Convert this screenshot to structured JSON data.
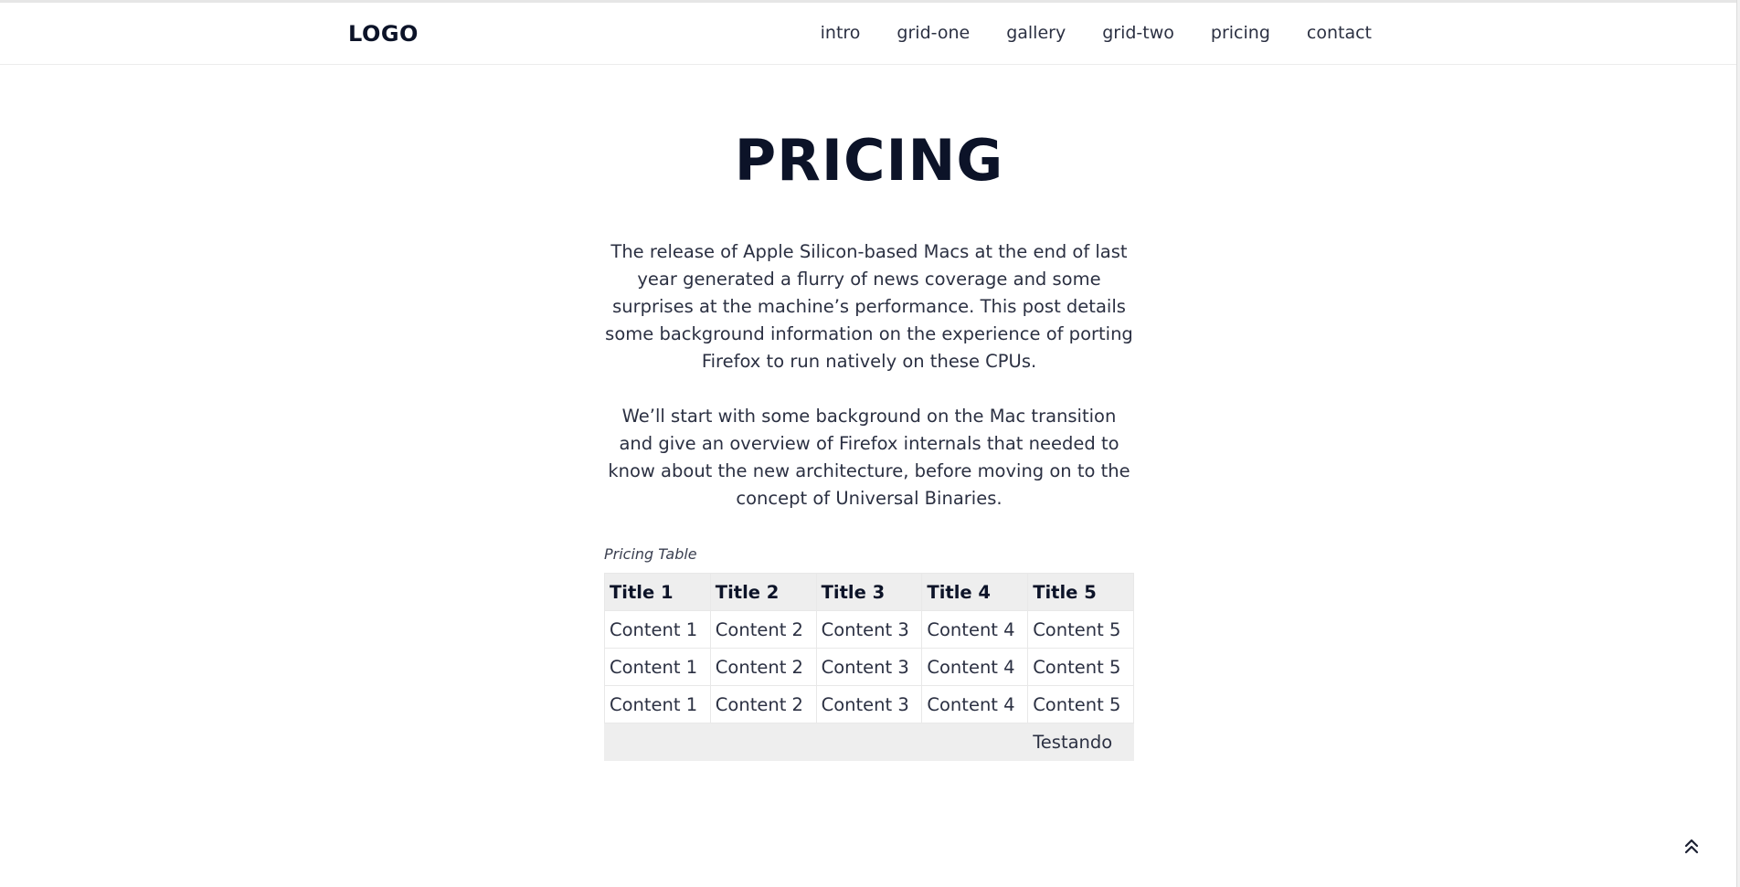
{
  "header": {
    "logo": "LOGO",
    "nav": [
      "intro",
      "grid-one",
      "gallery",
      "grid-two",
      "pricing",
      "contact"
    ]
  },
  "main": {
    "title": "PRICING",
    "paragraphs": [
      "The release of Apple Silicon-based Macs at the end of last year generated a flurry of news coverage and some surprises at the machine’s performance. This post details some background information on the experience of porting Firefox to run natively on these CPUs.",
      "We’ll start with some background on the Mac transition and give an overview of Firefox internals that needed to know about the new architecture, before moving on to the concept of Universal Binaries."
    ],
    "table": {
      "caption": "Pricing Table",
      "headers": [
        "Title 1",
        "Title 2",
        "Title 3",
        "Title 4",
        "Title 5"
      ],
      "rows": [
        [
          "Content 1",
          "Content 2",
          "Content 3",
          "Content 4",
          "Content 5"
        ],
        [
          "Content 1",
          "Content 2",
          "Content 3",
          "Content 4",
          "Content 5"
        ],
        [
          "Content 1",
          "Content 2",
          "Content 3",
          "Content 4",
          "Content 5"
        ]
      ],
      "footer": "Testando"
    }
  },
  "icons": {
    "back_to_top": "double-chevron-up-icon"
  }
}
